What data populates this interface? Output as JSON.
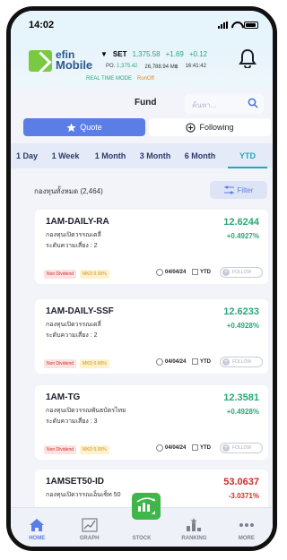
{
  "status_bar": {
    "time": "14:02"
  },
  "header": {
    "brand_line1": "efin",
    "brand_line2": "Mobile",
    "index_name": "SET",
    "index_value": "1,375.58",
    "index_change": "+1.69",
    "index_change_pct": "+0.12",
    "po_label": "PO.",
    "po_value": "1,375.42",
    "turnover": "26,788.94 M฿",
    "clock": "16:41:42",
    "mode_label": "REAL TIME MODE",
    "mode_state": "RunOff"
  },
  "page": {
    "title": "Fund",
    "search_placeholder": "ค้นหา..."
  },
  "segments": [
    {
      "label": "Quote",
      "icon": "star-icon",
      "active": true
    },
    {
      "label": "Following",
      "icon": "plus-circle-icon",
      "active": false
    }
  ],
  "periods": [
    {
      "label": "1 Day",
      "active": false
    },
    {
      "label": "1 Week",
      "active": false
    },
    {
      "label": "1 Month",
      "active": false
    },
    {
      "label": "3 Month",
      "active": false
    },
    {
      "label": "6 Month",
      "active": false
    },
    {
      "label": "YTD",
      "active": true
    }
  ],
  "list": {
    "count_text": "กองทุนทั้งหมด (2,464)",
    "filter_label": "Filter"
  },
  "funds": [
    {
      "name": "1AM-DAILY-RA",
      "type": "กองทุนเปิดวรรณเดลี่",
      "risk": "ระดับความเสี่ยง : 2",
      "price": "12.6244",
      "change": "+0.4927%",
      "direction": "up",
      "badge1": "Non Dividend",
      "badge2": "MKD 0.00%",
      "date": "04/04/24",
      "period": "YTD",
      "follow": "FOLLOW"
    },
    {
      "name": "1AM-DAILY-SSF",
      "type": "กองทุนเปิดวรรณเดลี่",
      "risk": "ระดับความเสี่ยง : 2",
      "price": "12.6233",
      "change": "+0.4928%",
      "direction": "up",
      "badge1": "Non Dividend",
      "badge2": "MKD 0.00%",
      "date": "04/04/24",
      "period": "YTD",
      "follow": "FOLLOW"
    },
    {
      "name": "1AM-TG",
      "type": "กองทุนเปิดวรรณพันธบัตรไทย",
      "risk": "ระดับความเสี่ยง : 3",
      "price": "12.3581",
      "change": "+0.4928%",
      "direction": "up",
      "badge1": "Non Dividend",
      "badge2": "MKD 0.00%",
      "date": "04/04/24",
      "period": "YTD",
      "follow": "FOLLOW"
    },
    {
      "name": "1AMSET50-ID",
      "type": "กองทุนเปิดวรรณเอ็นเซ็ท 50",
      "price": "53.0637",
      "change": "-3.0371%",
      "direction": "down"
    }
  ],
  "nav": [
    {
      "label": "HOME",
      "icon": "home-icon",
      "active": true
    },
    {
      "label": "GRAPH",
      "icon": "graph-icon",
      "active": false
    },
    {
      "label": "STOCK",
      "icon": "stock-icon",
      "active": false
    },
    {
      "label": "RANKING",
      "icon": "ranking-icon",
      "active": false
    },
    {
      "label": "MORE",
      "icon": "more-icon",
      "active": false
    }
  ],
  "colors": {
    "accent": "#5b7ee6",
    "tab_active": "#27a6b8",
    "up": "#2aa87a",
    "down": "#d42a2a",
    "stock_button": "#3fb54a"
  }
}
